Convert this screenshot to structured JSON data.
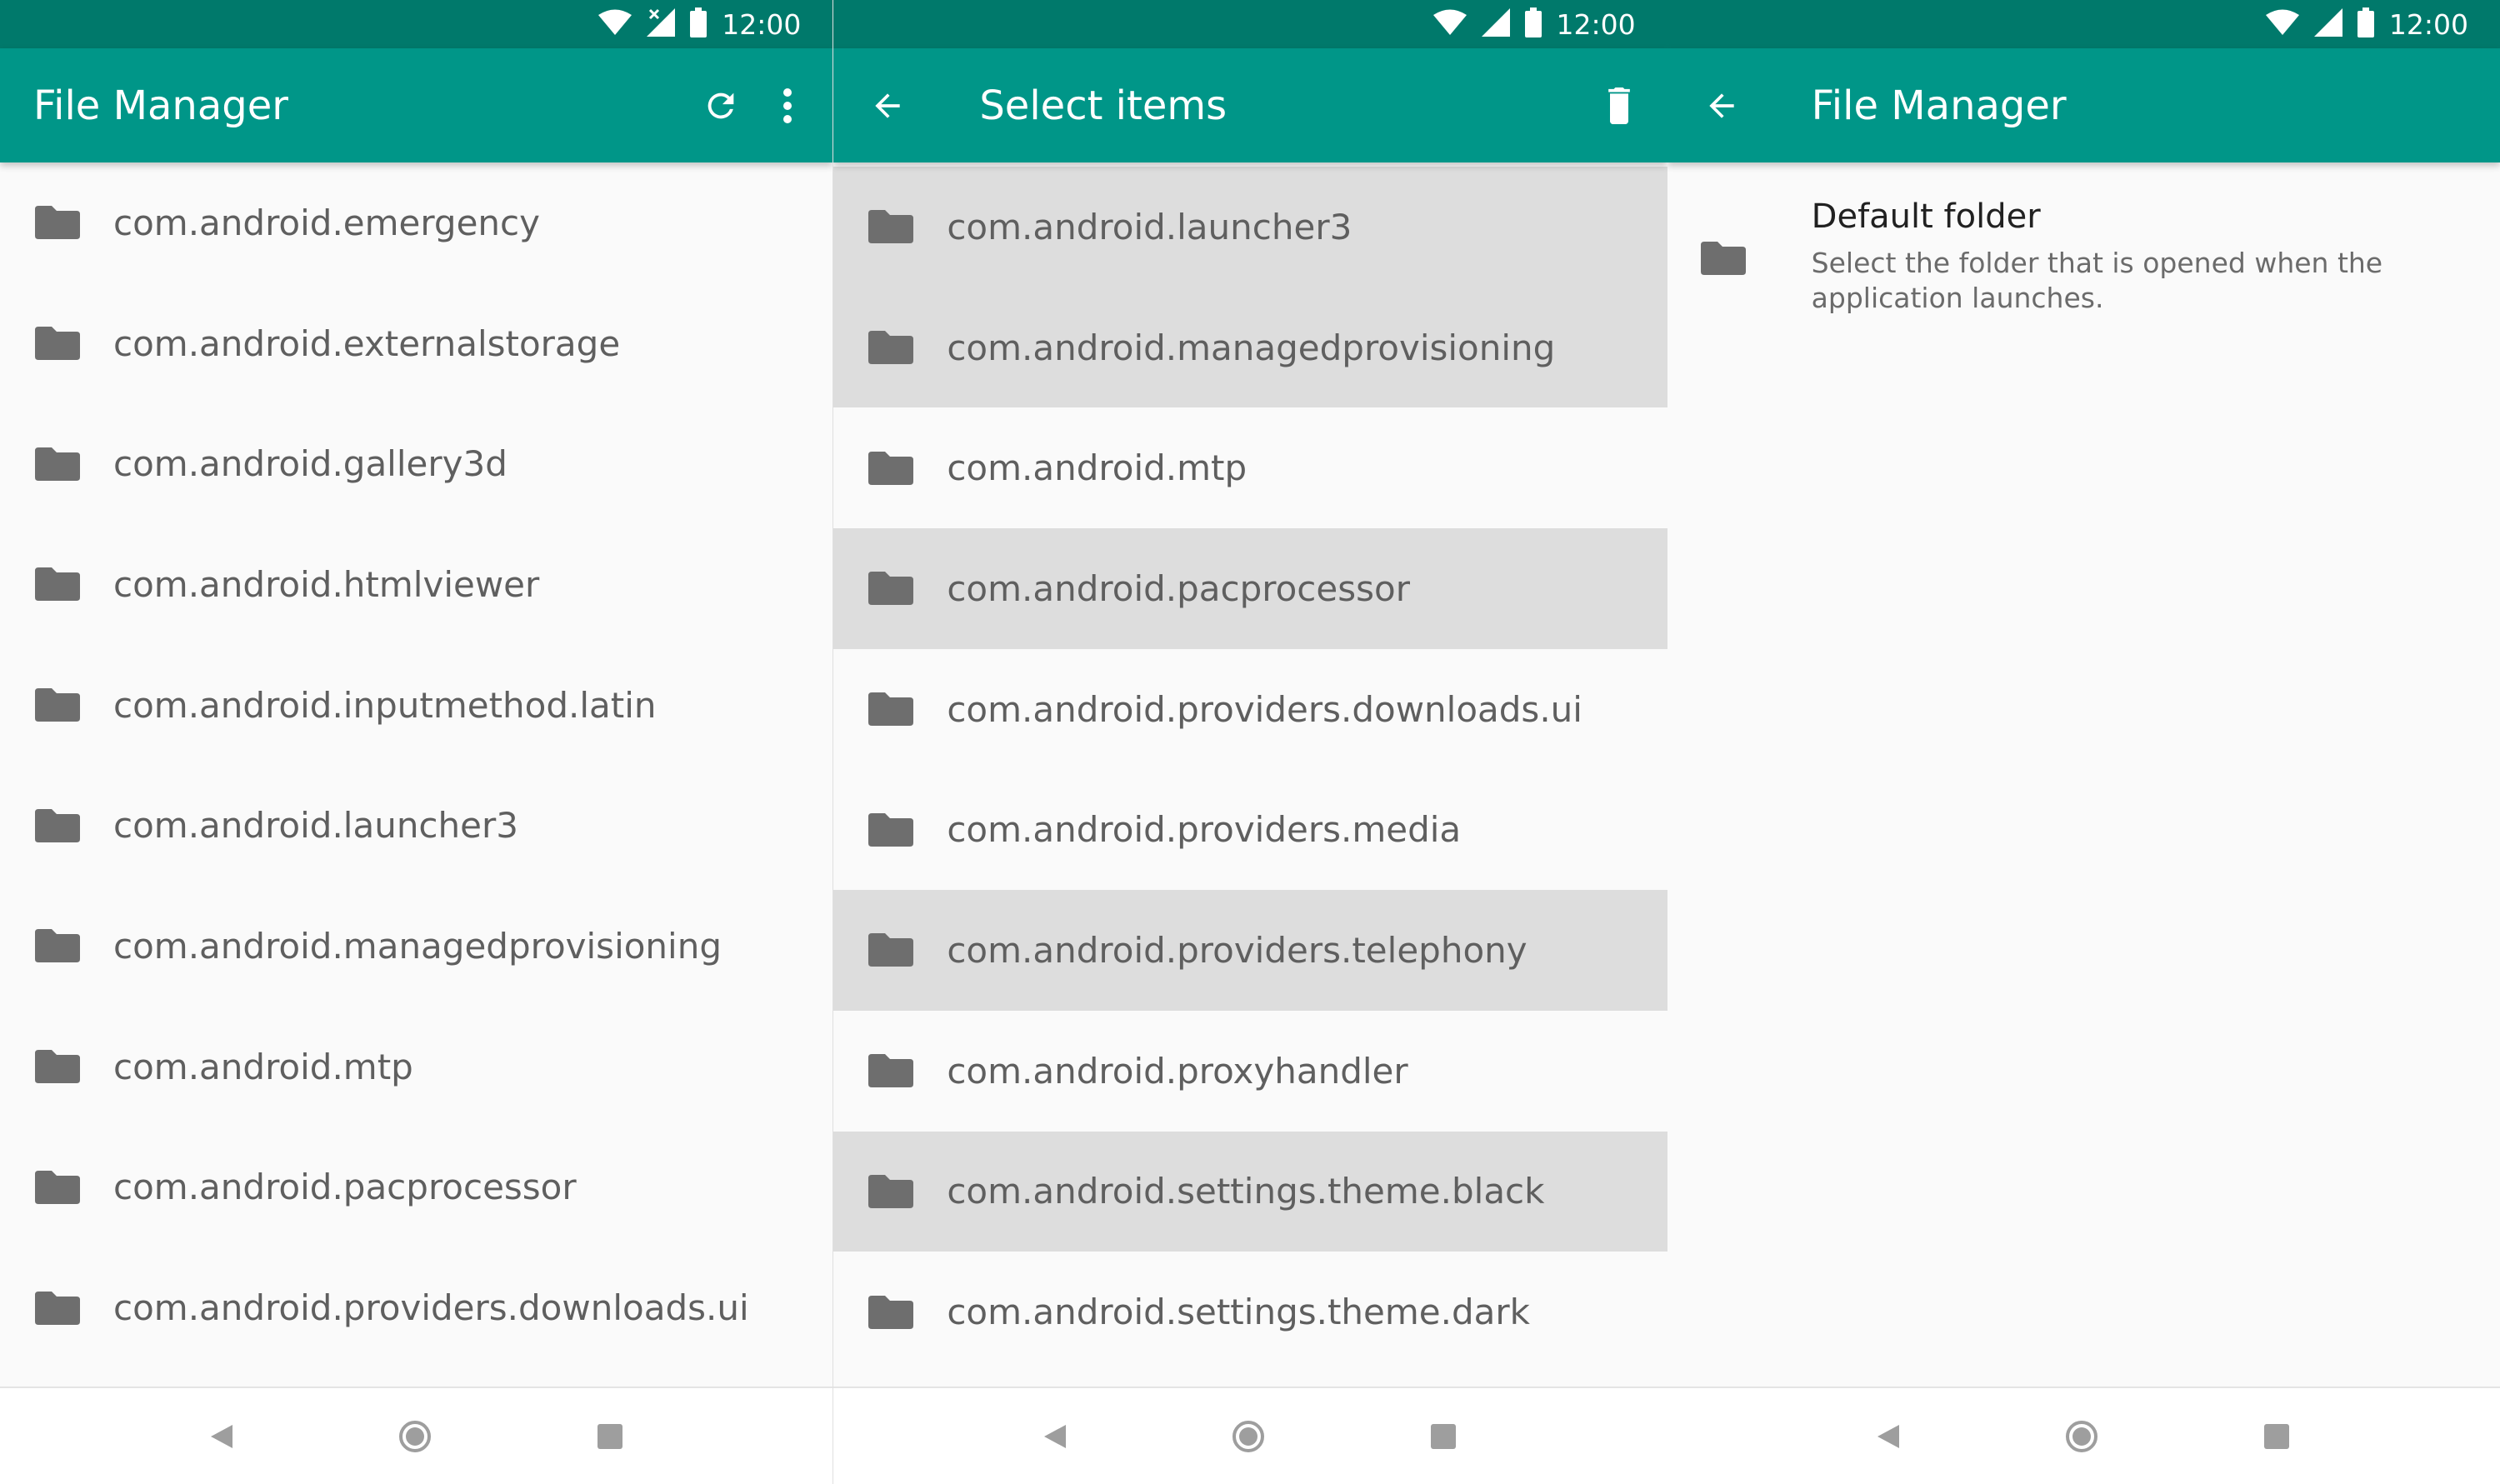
{
  "colors": {
    "primary": "#009688",
    "primary_dark": "#00796b",
    "selected_row": "#dddddd",
    "folder_icon": "#6e6e6e",
    "text": "#5f5f5f"
  },
  "status_bar": {
    "time": "12:00",
    "icons": [
      "wifi-icon",
      "signal-icon",
      "battery-icon"
    ]
  },
  "screen1": {
    "title": "File Manager",
    "actions": [
      "refresh-icon",
      "more-vert-icon"
    ],
    "items": [
      {
        "label": "com.android.emergency"
      },
      {
        "label": "com.android.externalstorage"
      },
      {
        "label": "com.android.gallery3d"
      },
      {
        "label": "com.android.htmlviewer"
      },
      {
        "label": "com.android.inputmethod.latin"
      },
      {
        "label": "com.android.launcher3"
      },
      {
        "label": "com.android.managedprovisioning"
      },
      {
        "label": "com.android.mtp"
      },
      {
        "label": "com.android.pacprocessor"
      },
      {
        "label": "com.android.providers.downloads.ui"
      }
    ]
  },
  "screen2": {
    "title": "Select items",
    "actions": [
      "back-arrow-icon",
      "delete-icon"
    ],
    "items": [
      {
        "label": "com.android.launcher3",
        "selected": true
      },
      {
        "label": "com.android.managedprovisioning",
        "selected": true
      },
      {
        "label": "com.android.mtp",
        "selected": false
      },
      {
        "label": "com.android.pacprocessor",
        "selected": true
      },
      {
        "label": "com.android.providers.downloads.ui",
        "selected": false
      },
      {
        "label": "com.android.providers.media",
        "selected": false
      },
      {
        "label": "com.android.providers.telephony",
        "selected": true
      },
      {
        "label": "com.android.proxyhandler",
        "selected": false
      },
      {
        "label": "com.android.settings.theme.black",
        "selected": true
      },
      {
        "label": "com.android.settings.theme.dark",
        "selected": false
      }
    ]
  },
  "screen3": {
    "title": "File Manager",
    "actions": [
      "back-arrow-icon"
    ],
    "preference": {
      "title": "Default folder",
      "summary": "Select the folder that is opened when the application launches."
    }
  },
  "nav_bar": [
    "nav-back-icon",
    "nav-home-icon",
    "nav-recents-icon"
  ]
}
